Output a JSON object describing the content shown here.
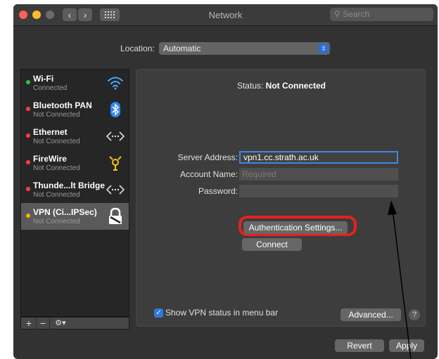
{
  "window": {
    "title": "Network",
    "search_placeholder": "Search"
  },
  "location": {
    "label": "Location:",
    "value": "Automatic"
  },
  "services": [
    {
      "name": "Wi-Fi",
      "status": "Connected",
      "dot_color": "#2ec440",
      "icon": "wifi-icon"
    },
    {
      "name": "Bluetooth PAN",
      "status": "Not Connected",
      "dot_color": "#ff4136",
      "icon": "bluetooth-icon"
    },
    {
      "name": "Ethernet",
      "status": "Not Connected",
      "dot_color": "#ff4136",
      "icon": "ethernet-icon"
    },
    {
      "name": "FireWire",
      "status": "Not Connected",
      "dot_color": "#ff4136",
      "icon": "firewire-icon"
    },
    {
      "name": "Thunde...lt Bridge",
      "status": "Not Connected",
      "dot_color": "#ff4136",
      "icon": "thunderbolt-bridge-icon"
    },
    {
      "name": "VPN (Ci...IPSec)",
      "status": "Not Connected",
      "dot_color": "#ffb300",
      "icon": "vpn-lock-icon",
      "selected": true
    }
  ],
  "sidebar_buttons": {
    "add": "+",
    "remove": "−",
    "action": "⚙▾"
  },
  "detail": {
    "status_label": "Status:",
    "status_value": "Not Connected",
    "server_address_label": "Server Address:",
    "server_address_value": "vpn1.cc.strath.ac.uk",
    "account_name_label": "Account Name:",
    "account_name_placeholder": "Required",
    "password_label": "Password:",
    "password_value": "",
    "auth_settings_button": "Authentication Settings...",
    "connect_button": "Connect",
    "show_vpn_status_label": "Show VPN status in menu bar",
    "show_vpn_status_checked": true,
    "advanced_button": "Advanced...",
    "help_button": "?"
  },
  "footer": {
    "revert_button": "Revert",
    "apply_button": "Apply"
  },
  "colors": {
    "highlight_ring": "#e8201c",
    "annotation_arrow": "#000000",
    "accent": "#2f78e0"
  }
}
